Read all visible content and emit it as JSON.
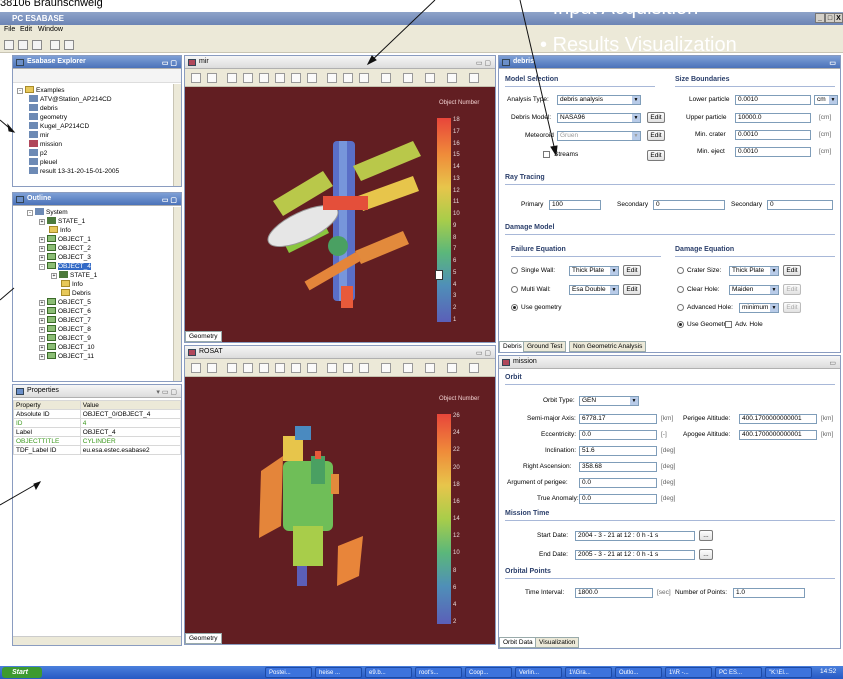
{
  "location_text": "38106 Braunschweig",
  "app": {
    "title": "PC ESABASE",
    "window_controls": [
      "_",
      "□",
      "X"
    ]
  },
  "menu": [
    "File",
    "Edit",
    "Window"
  ],
  "explorer": {
    "title": "Esabase Explorer",
    "root": "Examples",
    "items": [
      "ATV@Station_AP214CD",
      "debris",
      "geometry",
      "Kugel_AP214CD",
      "mir",
      "mission",
      "p2",
      "pleuel",
      "result 13-31-20-15-01-2005"
    ]
  },
  "outline": {
    "title": "Outline",
    "rows": [
      {
        "label": "System"
      },
      {
        "label": "STATE_1"
      },
      {
        "label": "Info"
      },
      {
        "label": "OBJECT_1"
      },
      {
        "label": "OBJECT_2"
      },
      {
        "label": "OBJECT_3"
      },
      {
        "label": "OBJECT_4"
      },
      {
        "label": "STATE_1"
      },
      {
        "label": "Info"
      },
      {
        "label": "Debris"
      },
      {
        "label": "OBJECT_5"
      },
      {
        "label": "OBJECT_6"
      },
      {
        "label": "OBJECT_7"
      },
      {
        "label": "OBJECT_8"
      },
      {
        "label": "OBJECT_9"
      },
      {
        "label": "OBJECT_10"
      },
      {
        "label": "OBJECT_11"
      }
    ]
  },
  "properties": {
    "title": "Properties",
    "headers": [
      "Property",
      "Value"
    ],
    "rows": [
      {
        "prop": "Absolute ID",
        "value": "OBJECT_0/OBJECT_4"
      },
      {
        "prop": "ID",
        "value": "4"
      },
      {
        "prop": "Label",
        "value": "OBJECT_4"
      },
      {
        "prop": "OBJECTTITLE",
        "value": "CYLINDER"
      },
      {
        "prop": "TDF_Label ID",
        "value": "eu.esa.estec.esabase2"
      }
    ]
  },
  "mir_view": {
    "tab": "mir",
    "legend_title": "Object Number",
    "scale": [
      "18",
      "17",
      "16",
      "15",
      "14",
      "13",
      "12",
      "11",
      "10",
      "9",
      "8",
      "7",
      "6",
      "5",
      "4",
      "3",
      "2",
      "1"
    ],
    "bottom_tab": "Geometry"
  },
  "rosat_view": {
    "tab": "ROSAT",
    "legend_title": "Object Number",
    "scale": [
      "26",
      "24",
      "22",
      "20",
      "18",
      "16",
      "14",
      "12",
      "10",
      "8",
      "6",
      "4",
      "2"
    ],
    "bottom_tab": "Geometry"
  },
  "debris": {
    "tab": "debris",
    "model_selection": "Model Selection",
    "analysis_type_label": "Analysis Type:",
    "analysis_type": "debris analysis",
    "debris_model_label": "Debris Model:",
    "debris_model": "NASA96",
    "meteoroid_label": "Meteoroid",
    "meteoroid": "Gruen",
    "edit": "Edit",
    "streams": "Streams",
    "size_boundaries": "Size Boundaries",
    "lower_particle_label": "Lower particle",
    "lower_particle": "0.0010",
    "lower_unit": "cm",
    "upper_particle_label": "Upper particle",
    "upper_particle": "10000.0",
    "min_crater_label": "Min. crater",
    "min_crater": "0.0010",
    "min_eject_label": "Min. eject",
    "min_eject": "0.0010",
    "unit_cm": "[cm]",
    "ray_tracing": "Ray Tracing",
    "primary_label": "Primary",
    "primary": "100",
    "secondary_label": "Secondary",
    "secondary": "0",
    "tertiary_label": "Secondary",
    "tertiary": "0",
    "damage_model": "Damage Model",
    "failure_equation": "Failure Equation",
    "single_wall": "Single Wall:",
    "single_wall_val": "Thick Plate",
    "multi_wall": "Multi Wall:",
    "multi_wall_val": "Esa Double",
    "use_geometry": "Use geometry",
    "damage_equation": "Damage Equation",
    "crater_size": "Crater Size:",
    "crater_size_val": "Thick Plate",
    "clear_hole": "Clear Hole:",
    "clear_hole_val": "Maiden",
    "adv_hole": "Advanced Hole:",
    "adv_hole_val": "minimum",
    "use_geometry2": "Use Geometry",
    "adv_hole_suffix": "Adv. Hole",
    "bottom_tabs": [
      "Debris",
      "Ground Test",
      "Non Geometric Analysis"
    ]
  },
  "mission": {
    "tab": "mission",
    "orbit": "Orbit",
    "orbit_type_label": "Orbit Type:",
    "orbit_type": "GEN",
    "semi_major_label": "Semi-major Axis:",
    "semi_major": "6778.17",
    "unit_km": "[km]",
    "ecc_label": "Eccentricity:",
    "ecc": "0.0",
    "unit_dash": "[-]",
    "incl_label": "Inclination:",
    "incl": "51.6",
    "unit_deg": "[deg]",
    "ra_label": "Right Ascension:",
    "ra": "358.68",
    "argp_label": "Argument of perigee:",
    "argp": "0.0",
    "ta_label": "True Anomaly:",
    "ta": "0.0",
    "perigee_label": "Perigee Altitude:",
    "perigee": "400.1700000000001",
    "apogee_label": "Apogee Altitude:",
    "apogee": "400.1700000000001",
    "mission_time": "Mission Time",
    "start_label": "Start Date:",
    "start_date": "2004 - 3 - 21 at 12 : 0 h -1 s",
    "end_label": "End Date:",
    "end_date": "2005 - 3 - 21 at 12 : 0 h -1 s",
    "browse": "...",
    "orbital_points": "Orbital Points",
    "interval_label": "Time Interval:",
    "interval": "1800.0",
    "unit_sec": "[sec]",
    "npoints_label": "Number of Points:",
    "npoints": "1.0",
    "bottom_tabs": [
      "Orbit Data",
      "Visualization"
    ]
  },
  "overlay": {
    "bullets": [
      "Input Acquisition",
      "Results Visualization",
      "...."
    ]
  },
  "taskbar": {
    "start": "Start",
    "items": [
      "Postei...",
      "heise ...",
      "e9.b...",
      "root's...",
      "Coop...",
      "Verlin...",
      "1\\\\Gra...",
      "Outlo...",
      "1\\\\R -...",
      "PC ES...",
      "\"K:\\El..."
    ],
    "clock": "14:52"
  }
}
